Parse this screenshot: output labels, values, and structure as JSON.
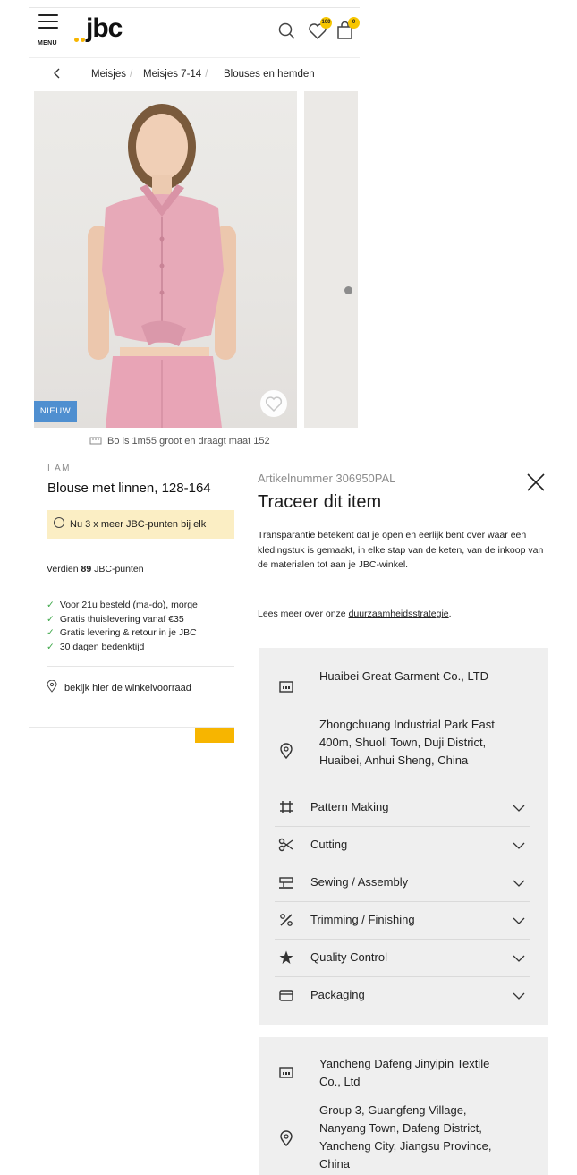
{
  "header": {
    "menu_label": "MENU",
    "logo_text": "jbc",
    "points_badge": "100",
    "cart_badge": "0"
  },
  "breadcrumb": {
    "items": [
      "Meisjes",
      "Meisjes 7-14",
      "Blouses en hemden"
    ]
  },
  "product": {
    "badge": "NIEUW",
    "model_info": "Bo is 1m55 groot en draagt maat 152",
    "brand": "I AM",
    "title": "Blouse met linnen, 128-164",
    "promo": "Nu 3 x meer JBC-punten bij elk",
    "points_prefix": "Verdien ",
    "points_value": "89",
    "points_suffix": " JBC-punten",
    "usps": [
      "Voor 21u besteld (ma-do), morge",
      "Gratis thuislevering vanaf €35",
      "Gratis levering & retour in je JBC",
      "30 dagen bedenktijd"
    ],
    "stock_link": "bekijk hier de winkelvoorraad"
  },
  "trace_panel": {
    "article_number": "Artikelnummer 306950PAL",
    "title": "Traceer dit item",
    "description": "Transparantie betekent dat je open en eerlijk bent over waar een kledingstuk is gemaakt, in elke stap van de keten, van de inkoop van de materialen tot aan je JBC-winkel.",
    "more_prefix": "Lees meer over onze ",
    "more_link": "duurzaamheidsstrategie",
    "more_suffix": ".",
    "suppliers": [
      {
        "name": "Huaibei Great Garment Co., LTD",
        "address": "Zhongchuang Industrial Park East 400m, Shuoli Town, Duji District, Huaibei, Anhui Sheng, China",
        "steps": [
          {
            "label": "Pattern Making",
            "icon": "pattern-making-icon"
          },
          {
            "label": "Cutting",
            "icon": "scissors-icon"
          },
          {
            "label": "Sewing / Assembly",
            "icon": "sewing-machine-icon"
          },
          {
            "label": "Trimming / Finishing",
            "icon": "trimming-icon"
          },
          {
            "label": "Quality Control",
            "icon": "star-icon"
          },
          {
            "label": "Packaging",
            "icon": "box-icon"
          }
        ]
      },
      {
        "name": "Yancheng Dafeng Jinyipin Textile Co., Ltd",
        "address": "Group 3, Guangfeng Village, Nanyang Town, Dafeng District, Yancheng City, Jiangsu Province, China"
      }
    ]
  },
  "colors": {
    "accent_yellow": "#f7b500",
    "badge_blue": "#4f8fd0",
    "promo_bg": "#fbeec4",
    "check_green": "#3fa84a"
  }
}
